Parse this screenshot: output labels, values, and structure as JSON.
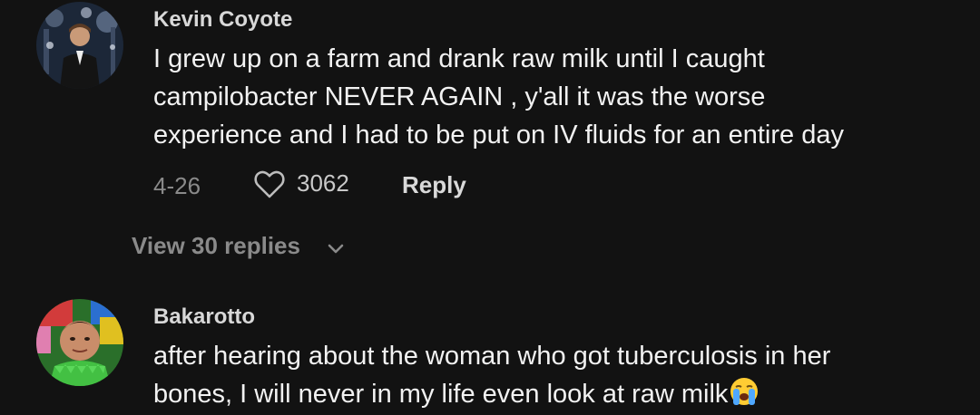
{
  "comments": [
    {
      "username": "Kevin Coyote",
      "text_lines": [
        "I grew up on a farm and drank raw milk until I caught",
        "campilobacter NEVER AGAIN , y'all it was the worse",
        "experience and I had to be put on IV fluids for an entire day"
      ],
      "date": "4-26",
      "like_icon": "heart-outline-icon",
      "likes": "3062",
      "reply_label": "Reply",
      "view_replies_label": "View 30 replies",
      "view_replies_icon": "chevron-down-icon"
    },
    {
      "username": "Bakarotto",
      "text_lines": [
        "after hearing about the woman who got tuberculosis in her",
        "bones, I will never in my life even look at raw milk"
      ],
      "trailing_emoji": "loudly-crying-face-emoji"
    }
  ],
  "colors": {
    "background": "#121212",
    "username": "#d8d8d8",
    "body_text": "#f2f2f2",
    "secondary_text": "#8a8a8a"
  }
}
